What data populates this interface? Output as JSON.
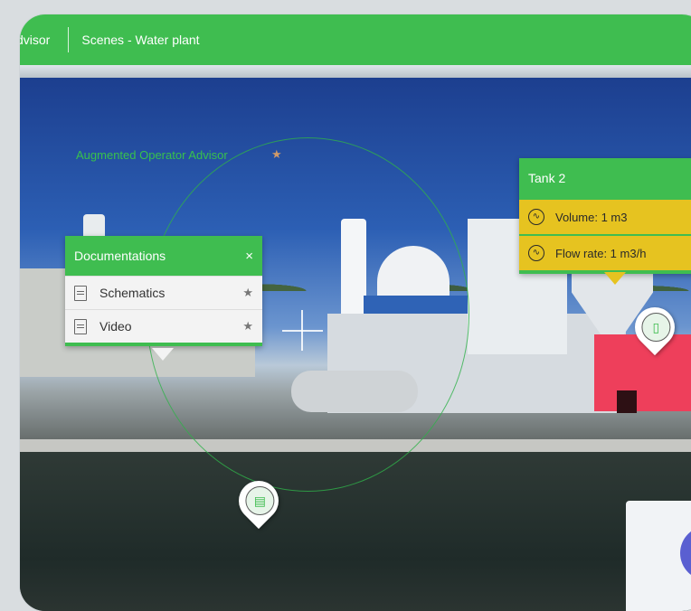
{
  "topbar": {
    "app_name": "dvisor",
    "breadcrumb": "Scenes - Water plant"
  },
  "overlay": {
    "title": "Augmented Operator Advisor",
    "star_icon": "star-icon"
  },
  "documentations_panel": {
    "title": "Documentations",
    "close_icon": "×",
    "items": [
      {
        "label": "Schematics",
        "icon": "file-icon",
        "favorite_icon": "★"
      },
      {
        "label": "Video",
        "icon": "file-icon",
        "favorite_icon": "★"
      }
    ]
  },
  "tank_panel": {
    "title": "Tank 2",
    "readings": [
      {
        "label": "Volume: 1 m3",
        "icon": "wave-icon"
      },
      {
        "label": "Flow rate: 1 m3/h",
        "icon": "wave-icon"
      }
    ]
  },
  "colors": {
    "accent_green": "#3fbd50",
    "reading_yellow": "#e6c320"
  }
}
